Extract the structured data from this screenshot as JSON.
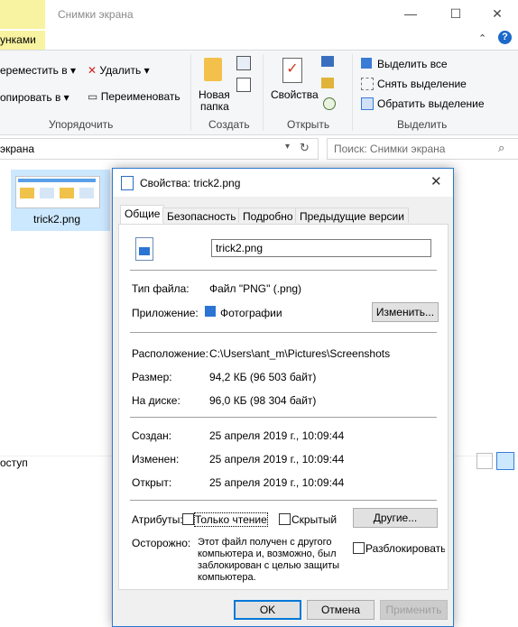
{
  "explorer": {
    "window_title": "Снимки экрана",
    "active_tab_fragment": "унками",
    "ribbon": {
      "organize": {
        "move_to": "ереместить в",
        "copy_to": "опировать в",
        "delete": "Удалить",
        "rename": "Переименовать",
        "group_label": "Упорядочить"
      },
      "create": {
        "new_folder_line1": "Новая",
        "new_folder_line2": "папка",
        "group_label": "Создать"
      },
      "open": {
        "properties": "Свойства",
        "group_label": "Открыть"
      },
      "select": {
        "select_all": "Выделить все",
        "select_none": "Снять выделение",
        "invert": "Обратить выделение",
        "group_label": "Выделить"
      }
    },
    "address_fragment": "экрана",
    "search_placeholder": "Поиск: Снимки экрана",
    "file": {
      "name": "trick2.png"
    },
    "status_fragment": "оступ"
  },
  "dialog": {
    "title": "Свойства: trick2.png",
    "tabs": [
      "Общие",
      "Безопасность",
      "Подробно",
      "Предыдущие версии"
    ],
    "filename": "trick2.png",
    "type_label": "Тип файла:",
    "type_value": "Файл \"PNG\" (.png)",
    "app_label": "Приложение:",
    "app_value": "Фотографии",
    "change_button": "Изменить...",
    "location_label": "Расположение:",
    "location_value": "C:\\Users\\ant_m\\Pictures\\Screenshots",
    "size_label": "Размер:",
    "size_value": "94,2 КБ (96 503 байт)",
    "disk_label": "На диске:",
    "disk_value": "96,0 КБ (98 304 байт)",
    "created_label": "Создан:",
    "created_value": "25 апреля 2019 г., 10:09:44",
    "modified_label": "Изменен:",
    "modified_value": "25 апреля 2019 г., 10:09:44",
    "accessed_label": "Открыт:",
    "accessed_value": "25 апреля 2019 г., 10:09:44",
    "attributes_label": "Атрибуты:",
    "readonly_label": "Только чтение",
    "hidden_label": "Скрытый",
    "other_button": "Другие...",
    "caution_label": "Осторожно:",
    "caution_text": [
      "Этот файл получен с другого",
      "компьютера и, возможно, был",
      "заблокирован с целью защиты",
      "компьютера."
    ],
    "unblock_label": "Разблокировать",
    "ok_button": "OK",
    "cancel_button": "Отмена",
    "apply_button": "Применить"
  }
}
